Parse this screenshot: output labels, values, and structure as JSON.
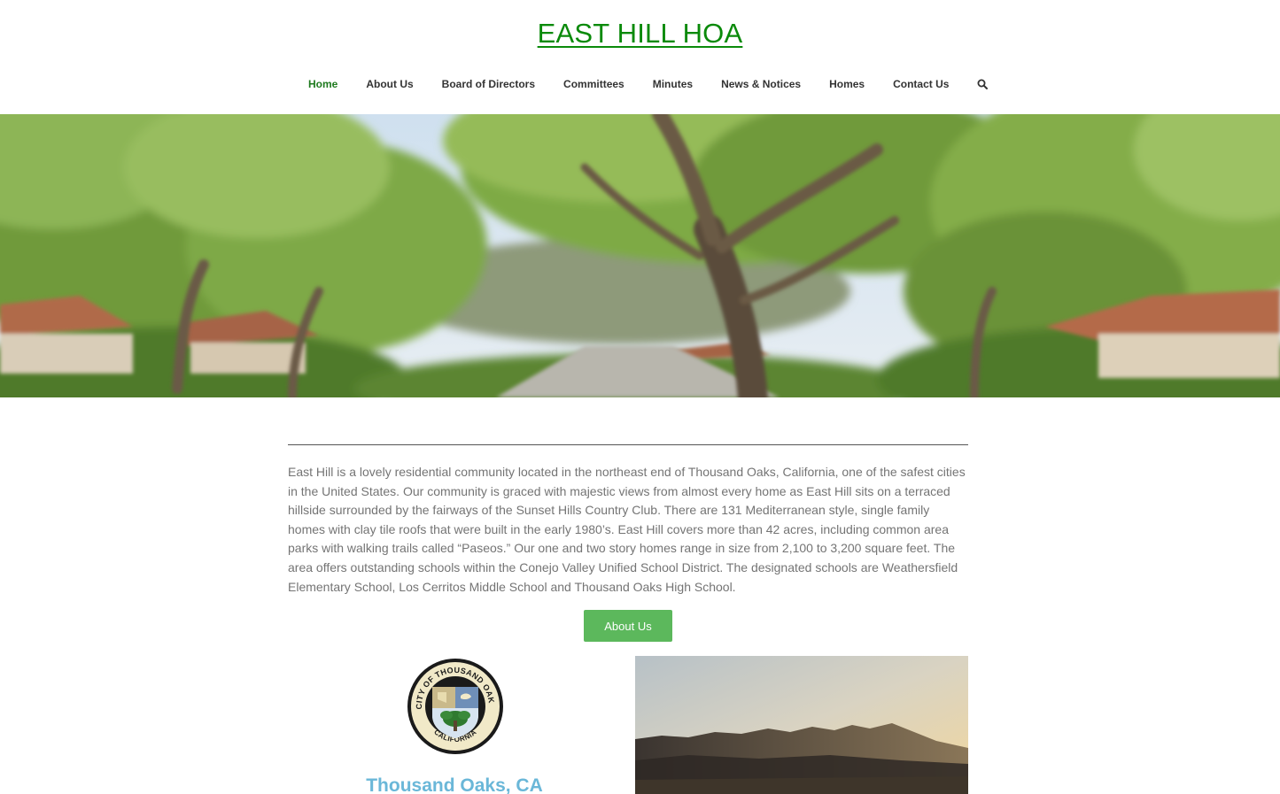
{
  "site": {
    "title": "EAST HILL HOA",
    "accent_color": "#0a8a0a"
  },
  "nav": {
    "items": [
      {
        "label": "Home",
        "active": true
      },
      {
        "label": "About Us"
      },
      {
        "label": "Board of Directors"
      },
      {
        "label": "Committees"
      },
      {
        "label": "Minutes"
      },
      {
        "label": "News & Notices"
      },
      {
        "label": "Homes"
      },
      {
        "label": "Contact Us"
      }
    ],
    "search_icon": "search-icon"
  },
  "hero": {
    "image": "tree-lined-street-photo"
  },
  "intro": {
    "text": "East Hill is a lovely residential community located in the  northeast end of Thousand Oaks, California, one of the safest cities in the United States. Our community is graced with majestic views from almost every home as East Hill sits on a terraced hillside surrounded by the fairways of the Sunset Hills Country Club. There are 131 Mediterranean style, single family homes with clay tile roofs that  were built in the early 1980’s.  East Hill covers more than 42 acres, including common area parks with walking trails called “Paseos.”  Our one and two story homes range in size from 2,100 to 3,200 square feet.   The area offers outstanding schools within the Conejo Valley Unified School District.  The designated schools are Weathersfield Elementary School, Los Cerritos Middle School and Thousand Oaks High School."
  },
  "cta": {
    "about_label": "About Us",
    "color": "#5cb85c"
  },
  "city": {
    "seal_top_text": "CITY OF THOUSAND OAKS",
    "seal_bottom_text": "CALIFORNIA",
    "heading": "Thousand Oaks, CA",
    "heading_color": "#6ab7d8"
  },
  "photo": {
    "image": "mountain-sunset-photo"
  }
}
